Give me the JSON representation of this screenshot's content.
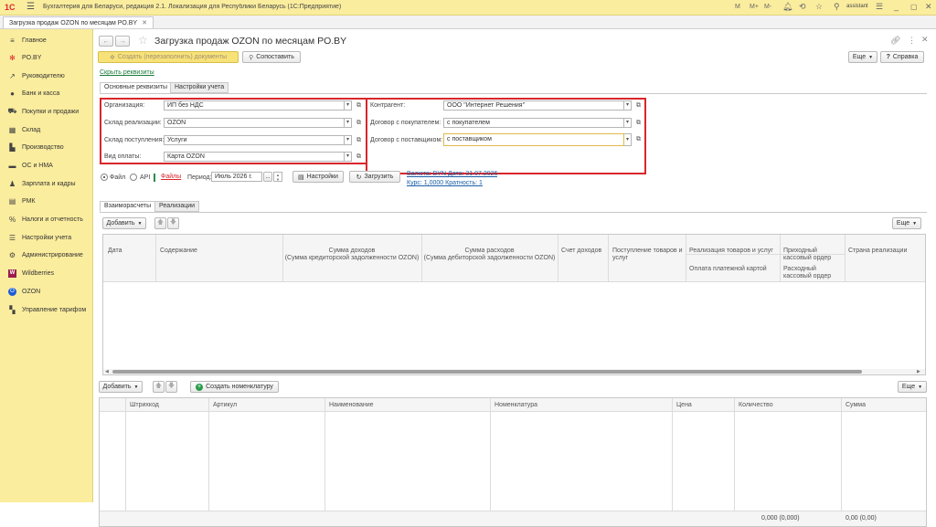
{
  "app": {
    "title": "Бухгалтерия для Беларуси, редакция 2.1. Локализация для Республики Беларусь  (1С:Предприятие)",
    "user": "assistant",
    "top_icons": [
      "M",
      "M+",
      "M-"
    ]
  },
  "window_tab": "Загрузка продаж OZON по месяцам PO.BY",
  "sidebar": {
    "items": [
      {
        "label": "Главное",
        "icon": "menu-icon"
      },
      {
        "label": "PO.BY",
        "icon": "star-icon"
      },
      {
        "label": "Руководителю",
        "icon": "chart-icon"
      },
      {
        "label": "Банк и касса",
        "icon": "bank-icon"
      },
      {
        "label": "Покупки и продажи",
        "icon": "cart-icon"
      },
      {
        "label": "Склад",
        "icon": "warehouse-icon"
      },
      {
        "label": "Производство",
        "icon": "factory-icon"
      },
      {
        "label": "ОС и НМА",
        "icon": "truck-icon"
      },
      {
        "label": "Зарплата и кадры",
        "icon": "people-icon"
      },
      {
        "label": "РМК",
        "icon": "cash-register-icon"
      },
      {
        "label": "Налоги и отчетность",
        "icon": "percent-icon"
      },
      {
        "label": "Настройки учета",
        "icon": "settings-icon"
      },
      {
        "label": "Администрирование",
        "icon": "gear-icon"
      },
      {
        "label": "Wildberries",
        "icon": "wildberries-icon"
      },
      {
        "label": "OZON",
        "icon": "ozon-icon"
      },
      {
        "label": "Управление тарифом",
        "icon": "tariff-icon"
      }
    ]
  },
  "form": {
    "title": "Загрузка продаж OZON по месяцам PO.BY",
    "btn_create": "Создать (перезаполнить) документы",
    "btn_compare": "Сопоставить",
    "btn_more": "Еще",
    "btn_help": "Справка",
    "hide_details_link": "Скрыть реквизиты",
    "tabs": [
      "Основные реквизиты",
      "Настройки учета"
    ],
    "fields_left": [
      {
        "label": "Организация:",
        "value": "ИП без НДС"
      },
      {
        "label": "Склад реализации:",
        "value": "OZON"
      },
      {
        "label": "Склад поступления:",
        "value": "Услуги"
      },
      {
        "label": "Вид оплаты:",
        "value": "Карта OZON"
      }
    ],
    "fields_right": [
      {
        "label": "Контрагент:",
        "value": "ООО \"Интернет Решения\""
      },
      {
        "label": "Договор с покупателем:",
        "value": "с покупателем"
      },
      {
        "label": "Договор с поставщиком:",
        "value": "с поставщиком"
      }
    ],
    "source": {
      "file_label": "Файл",
      "api_label": "API",
      "files_link": "Файлы",
      "period_label": "Период:",
      "period_value": "Июль 2026 г.",
      "period_btn": "...",
      "settings_btn": "Настройки",
      "load_btn": "Загрузить",
      "currency_link": "Валюта: BYN Дата: 31.07.2026",
      "rate_link": "Курс: 1,0000 Кратность: 1"
    },
    "lower_tabs": [
      "Взаиморасчеты",
      "Реализации"
    ],
    "table1": {
      "add_btn": "Добавить",
      "more_btn": "Еще",
      "headers": [
        "Дата",
        "Содержание",
        "Сумма доходов\n(Сумма кредиторской задолженности OZON)",
        "Сумма расходов\n(Сумма дебиторской задолженности OZON)",
        "Счет доходов",
        "Поступление товаров и услуг",
        "Реализация товаров и услуг",
        "Приходный кассовый ордер",
        "Страна реализации",
        "Оплата платежной картой",
        "Расходный кассовый ордер"
      ]
    },
    "table2": {
      "add_btn": "Добавить",
      "create_nom_btn": "Создать номенклатуру",
      "more_btn": "Еще",
      "headers": [
        "Штрихкод",
        "Артикул",
        "Наименование",
        "Номенклатура",
        "Цена",
        "Количество",
        "Сумма"
      ],
      "total_qty": "0,000 (0,000)",
      "total_sum": "0,00 (0,00)"
    }
  },
  "colors": {
    "sidebar_bg": "#fbed9e",
    "highlight_red": "#d9262b",
    "link": "#1a5fa8",
    "accent_btn": "#f7e27a"
  }
}
